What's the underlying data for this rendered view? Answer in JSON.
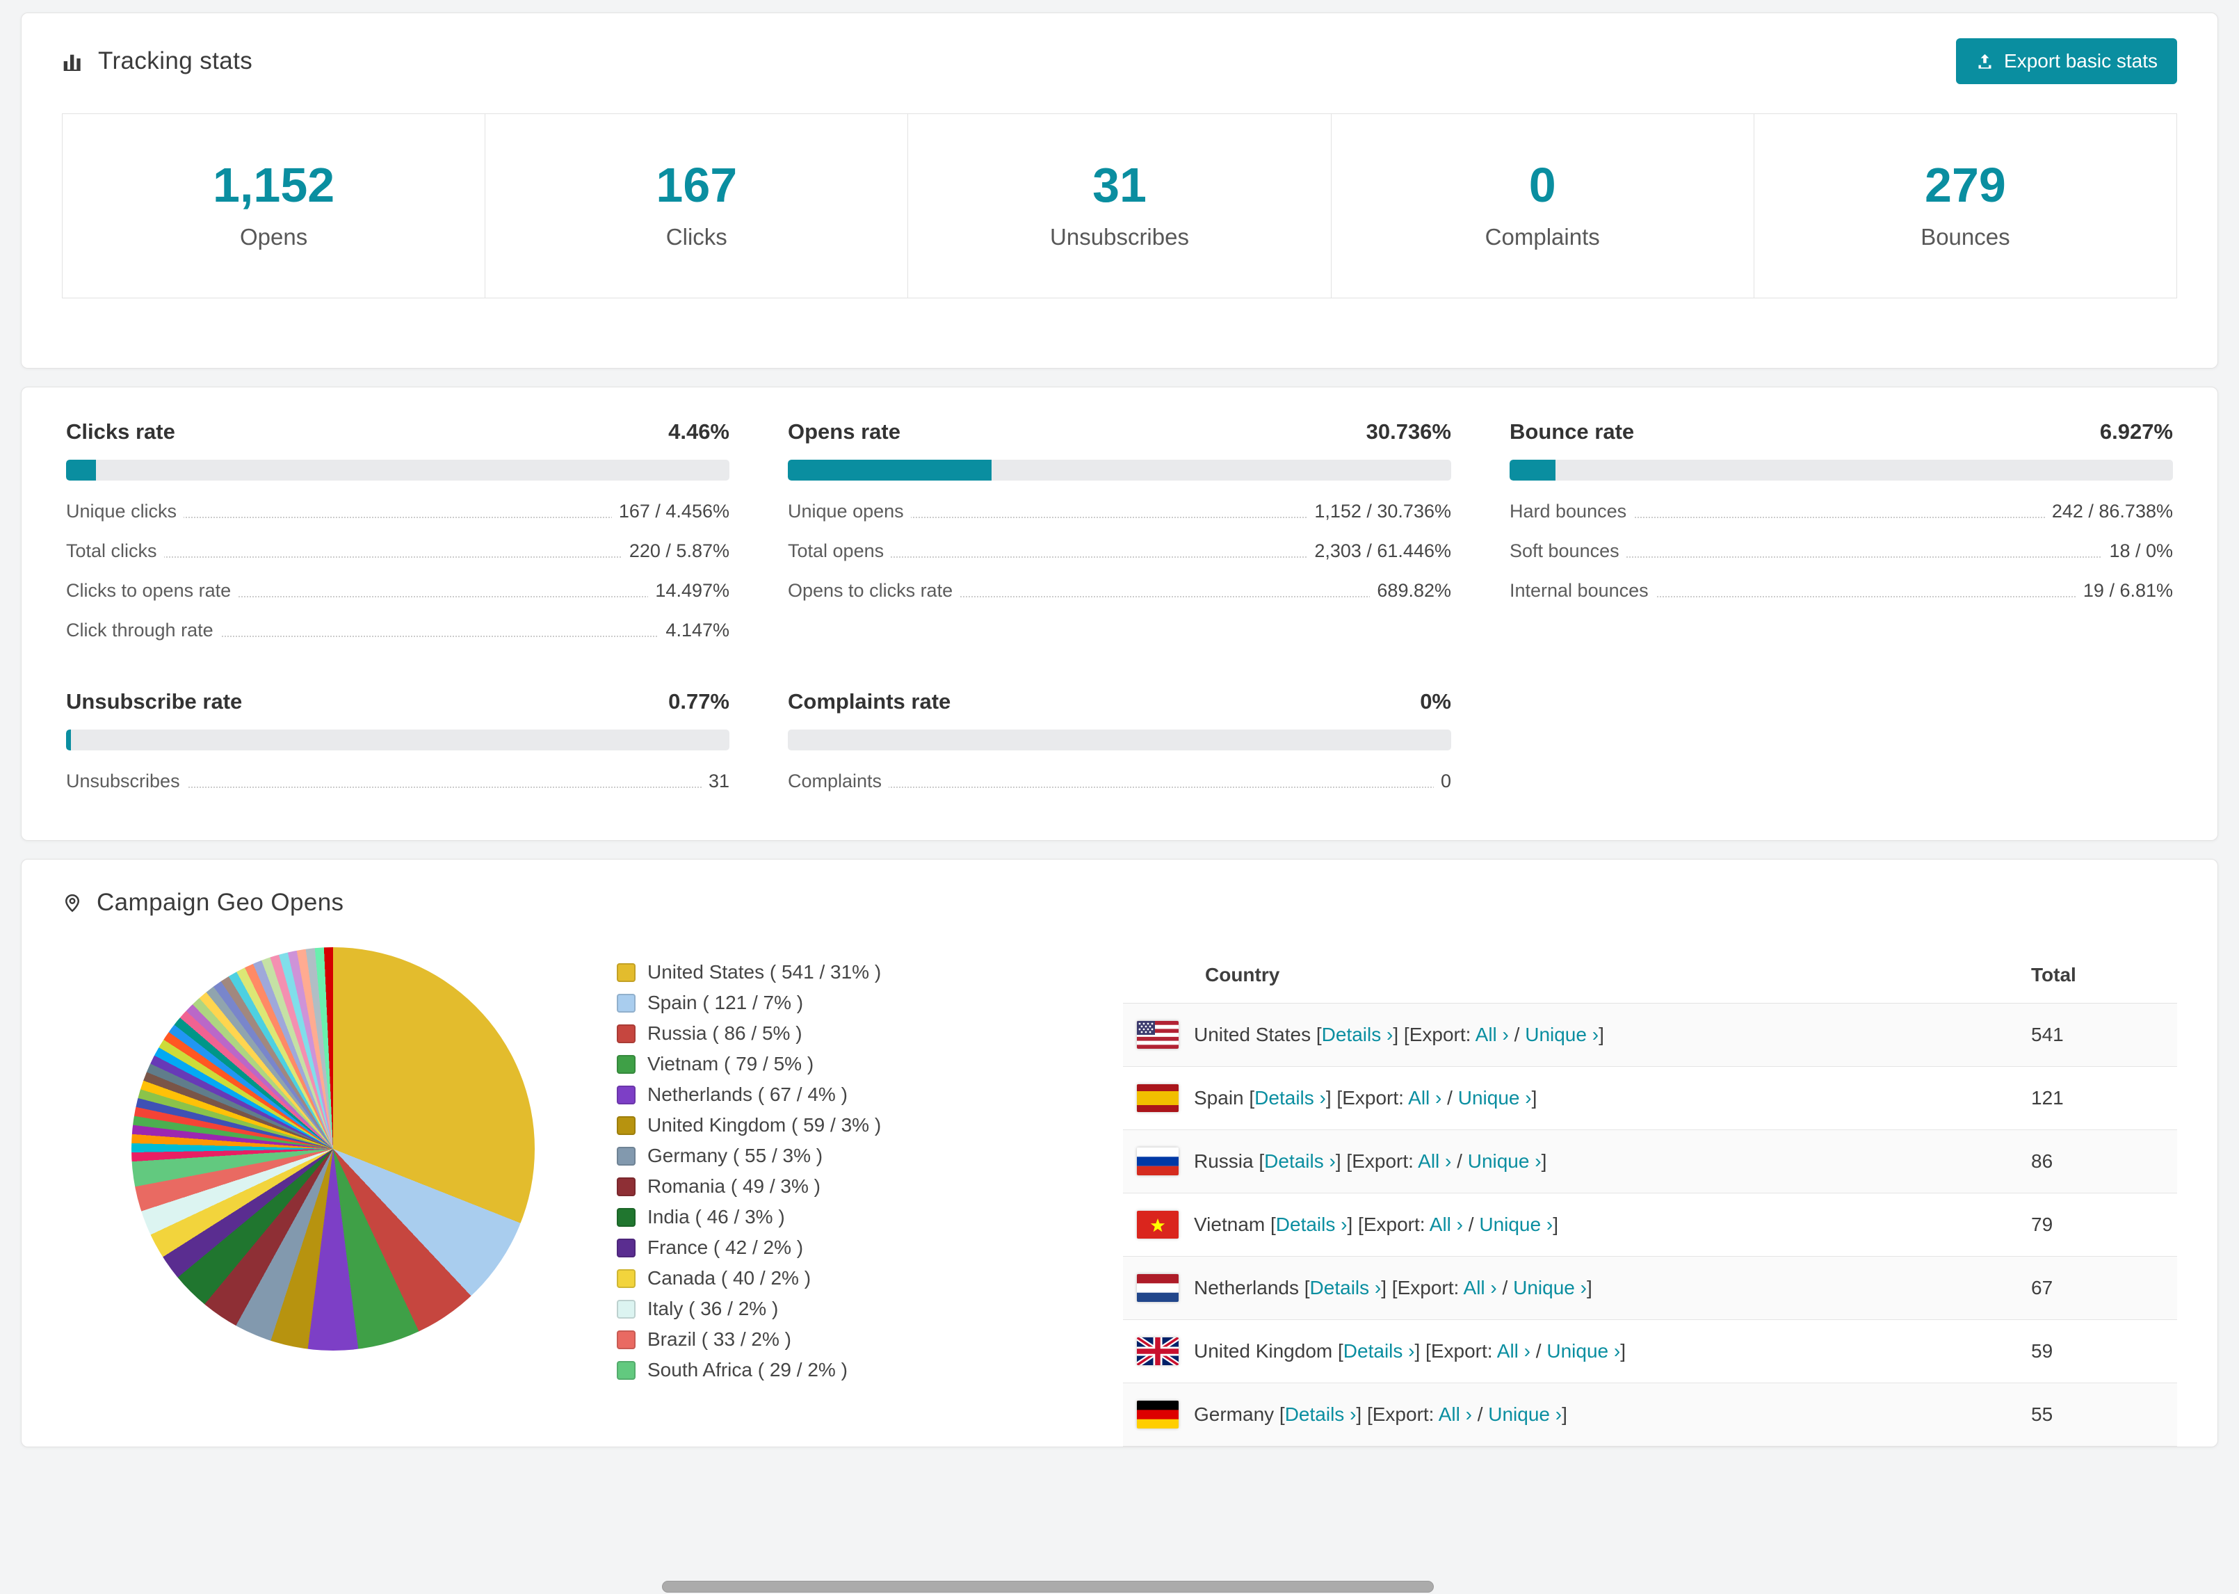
{
  "colors": {
    "accent": "#0A8EA0"
  },
  "tracking": {
    "title": "Tracking stats",
    "export_button": "Export basic stats",
    "boxes": [
      {
        "value": "1,152",
        "label": "Opens"
      },
      {
        "value": "167",
        "label": "Clicks"
      },
      {
        "value": "31",
        "label": "Unsubscribes"
      },
      {
        "value": "0",
        "label": "Complaints"
      },
      {
        "value": "279",
        "label": "Bounces"
      }
    ]
  },
  "rates": [
    {
      "title": "Clicks rate",
      "value": "4.46%",
      "percent": 4.46,
      "rows": [
        {
          "label": "Unique clicks",
          "value": "167 / 4.456%"
        },
        {
          "label": "Total clicks",
          "value": "220 / 5.87%"
        },
        {
          "label": "Clicks to opens rate",
          "value": "14.497%"
        },
        {
          "label": "Click through rate",
          "value": "4.147%"
        }
      ]
    },
    {
      "title": "Opens rate",
      "value": "30.736%",
      "percent": 30.736,
      "rows": [
        {
          "label": "Unique opens",
          "value": "1,152 / 30.736%"
        },
        {
          "label": "Total opens",
          "value": "2,303 / 61.446%"
        },
        {
          "label": "Opens to clicks rate",
          "value": "689.82%"
        }
      ]
    },
    {
      "title": "Bounce rate",
      "value": "6.927%",
      "percent": 6.927,
      "rows": [
        {
          "label": "Hard bounces",
          "value": "242 / 86.738%"
        },
        {
          "label": "Soft bounces",
          "value": "18 / 0%"
        },
        {
          "label": "Internal bounces",
          "value": "19 / 6.81%"
        }
      ]
    },
    {
      "title": "Unsubscribe rate",
      "value": "0.77%",
      "percent": 0.77,
      "rows": [
        {
          "label": "Unsubscribes",
          "value": "31"
        }
      ]
    },
    {
      "title": "Complaints rate",
      "value": "0%",
      "percent": 0,
      "rows": [
        {
          "label": "Complaints",
          "value": "0"
        }
      ]
    }
  ],
  "geo": {
    "title": "Campaign Geo Opens",
    "chart_data": {
      "type": "pie",
      "title": "Campaign Geo Opens",
      "slices": [
        {
          "name": "United States",
          "count": 541,
          "pct": 31,
          "color": "#E3BC2D"
        },
        {
          "name": "Spain",
          "count": 121,
          "pct": 7,
          "color": "#A9CDEE"
        },
        {
          "name": "Russia",
          "count": 86,
          "pct": 5,
          "color": "#C6463F"
        },
        {
          "name": "Vietnam",
          "count": 79,
          "pct": 5,
          "color": "#3FA047"
        },
        {
          "name": "Netherlands",
          "count": 67,
          "pct": 4,
          "color": "#7D3FC6"
        },
        {
          "name": "United Kingdom",
          "count": 59,
          "pct": 3,
          "color": "#B7930F"
        },
        {
          "name": "Germany",
          "count": 55,
          "pct": 3,
          "color": "#8299AE"
        },
        {
          "name": "Romania",
          "count": 49,
          "pct": 3,
          "color": "#8E2F35"
        },
        {
          "name": "India",
          "count": 46,
          "pct": 3,
          "color": "#20762F"
        },
        {
          "name": "France",
          "count": 42,
          "pct": 2,
          "color": "#5A2D90"
        },
        {
          "name": "Canada",
          "count": 40,
          "pct": 2,
          "color": "#F2D43C"
        },
        {
          "name": "Italy",
          "count": 36,
          "pct": 2,
          "color": "#DCF4F1"
        },
        {
          "name": "Brazil",
          "count": 33,
          "pct": 2,
          "color": "#E96A62"
        },
        {
          "name": "South Africa",
          "count": 29,
          "pct": 2,
          "color": "#62C97F"
        }
      ],
      "other_colors": [
        "#E91E63",
        "#00BCD4",
        "#FF9800",
        "#9C27B0",
        "#4CAF50",
        "#F44336",
        "#3F51B5",
        "#8BC34A",
        "#FFC107",
        "#795548",
        "#607D8B",
        "#673AB7",
        "#03A9F4",
        "#CDDC39",
        "#FF5722",
        "#2196F3",
        "#009688",
        "#F06292",
        "#BA68C8",
        "#AED581",
        "#FFD54F",
        "#90A4AE",
        "#7986CB",
        "#A1887F",
        "#4DD0E1",
        "#DCE775",
        "#FF8A65",
        "#9FA8DA",
        "#C5E1A5",
        "#F48FB1",
        "#80DEEA",
        "#CE93D8",
        "#FFAB91",
        "#B0BEC5",
        "#69F0AE",
        "#D50000"
      ]
    },
    "table": {
      "headers": [
        "Country",
        "Total"
      ],
      "links": {
        "details": "Details",
        "export": "Export:",
        "all": "All",
        "unique": "Unique",
        "chevron": "›"
      },
      "rows": [
        {
          "country": "United States",
          "flag": "us",
          "total": "541"
        },
        {
          "country": "Spain",
          "flag": "es",
          "total": "121"
        },
        {
          "country": "Russia",
          "flag": "ru",
          "total": "86"
        },
        {
          "country": "Vietnam",
          "flag": "vn",
          "total": "79"
        },
        {
          "country": "Netherlands",
          "flag": "nl",
          "total": "67"
        },
        {
          "country": "United Kingdom",
          "flag": "gb",
          "total": "59"
        },
        {
          "country": "Germany",
          "flag": "de",
          "total": "55"
        }
      ]
    }
  }
}
